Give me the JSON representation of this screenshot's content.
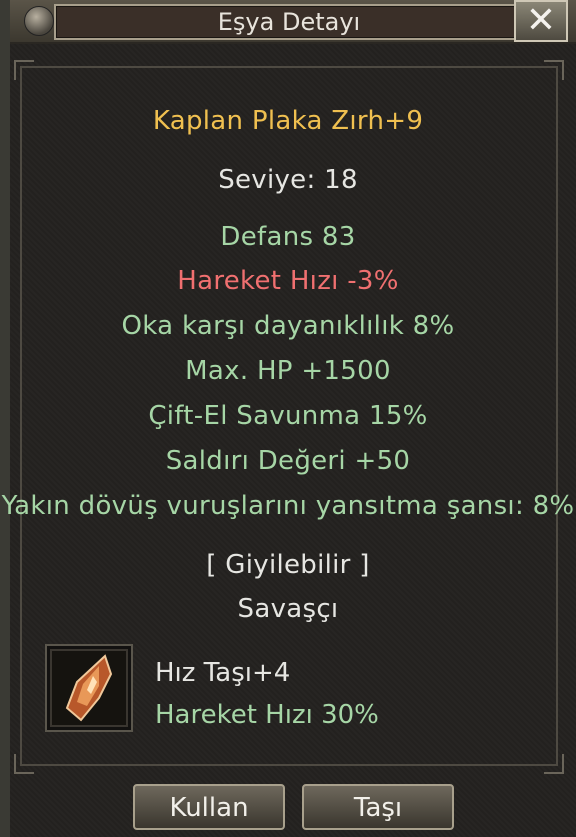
{
  "window": {
    "title": "Eşya Detayı",
    "close_label": "✕"
  },
  "item": {
    "name": "Kaplan Plaka Zırh+9",
    "level": "Seviye: 18",
    "stats": [
      "Defans 83",
      "Hareket Hızı -3%",
      "Oka karşı dayanıklılık 8%",
      "Max. HP +1500",
      "Çift-El Savunma 15%",
      "Saldırı Değeri +50",
      "Yakın dövüş vuruşlarını yansıtma şansı: 8%"
    ],
    "wearable": "[ Giyilebilir ]",
    "class": "Savaşçı"
  },
  "socket": {
    "stone_name": "Hız Taşı+4",
    "stone_effect": "Hareket Hızı 30%",
    "icon": "orange-gem-icon"
  },
  "buttons": {
    "use": "Kullan",
    "move": "Taşı"
  },
  "colors": {
    "name": "#f0c050",
    "bonus": "#a6d6a6",
    "penalty": "#f07070",
    "text": "#e6e6e2"
  }
}
